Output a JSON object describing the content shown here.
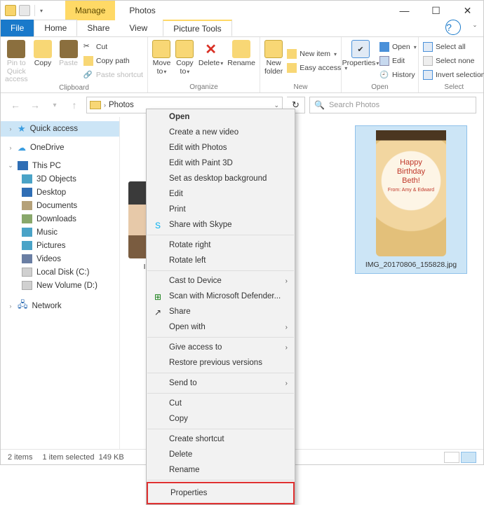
{
  "window": {
    "title": "Photos",
    "contextual_tab": "Manage",
    "contextual_group": "Picture Tools"
  },
  "tabs": {
    "file": "File",
    "home": "Home",
    "share": "Share",
    "view": "View",
    "picture_tools": "Picture Tools",
    "help_tip": "?"
  },
  "ribbon": {
    "clipboard": {
      "label": "Clipboard",
      "pin": "Pin to Quick access",
      "copy": "Copy",
      "paste": "Paste",
      "cut": "Cut",
      "copy_path": "Copy path",
      "paste_shortcut": "Paste shortcut"
    },
    "organize": {
      "label": "Organize",
      "move_to": "Move to",
      "copy_to": "Copy to",
      "delete": "Delete",
      "rename": "Rename"
    },
    "new": {
      "label": "New",
      "new_folder": "New folder",
      "new_item": "New item",
      "easy_access": "Easy access"
    },
    "open": {
      "label": "Open",
      "properties": "Properties",
      "open": "Open",
      "edit": "Edit",
      "history": "History"
    },
    "select": {
      "label": "Select",
      "select_all": "Select all",
      "select_none": "Select none",
      "invert": "Invert selection"
    }
  },
  "address": {
    "crumb_sep": ">",
    "location": "Photos",
    "search_placeholder": "Search Photos"
  },
  "sidebar": {
    "quick_access": "Quick access",
    "onedrive": "OneDrive",
    "this_pc": "This PC",
    "objects3d": "3D Objects",
    "desktop": "Desktop",
    "documents": "Documents",
    "downloads": "Downloads",
    "music": "Music",
    "pictures": "Pictures",
    "videos": "Videos",
    "local_disk": "Local Disk (C:)",
    "new_volume": "New Volume (D:)",
    "network": "Network"
  },
  "files": {
    "item1_caption_prefix": "IMG",
    "item2_caption": "IMG_20170806_155828.jpg",
    "cake_lines": [
      "Happy",
      "Birthday",
      "Beth!"
    ],
    "cake_sub": "From: Amy & Edward"
  },
  "context_menu": {
    "open": "Open",
    "create_video": "Create a new video",
    "edit_photos": "Edit with Photos",
    "edit_paint3d": "Edit with Paint 3D",
    "set_bg": "Set as desktop background",
    "edit": "Edit",
    "print": "Print",
    "share_skype": "Share with Skype",
    "rotate_right": "Rotate right",
    "rotate_left": "Rotate left",
    "cast": "Cast to Device",
    "scan_defender": "Scan with Microsoft Defender...",
    "share": "Share",
    "open_with": "Open with",
    "give_access": "Give access to",
    "restore_prev": "Restore previous versions",
    "send_to": "Send to",
    "cut": "Cut",
    "copy": "Copy",
    "create_shortcut": "Create shortcut",
    "delete": "Delete",
    "rename": "Rename",
    "properties": "Properties"
  },
  "status": {
    "item_count": "2 items",
    "selection": "1 item selected",
    "size": "149 KB"
  }
}
